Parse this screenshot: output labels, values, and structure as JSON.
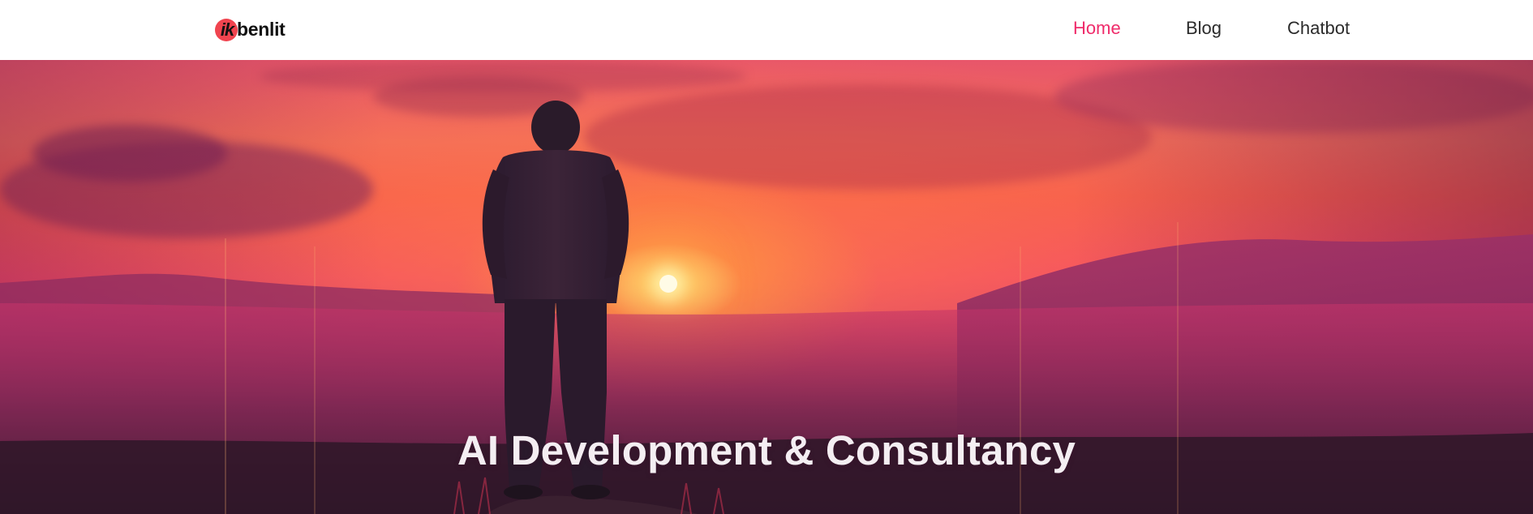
{
  "header": {
    "logo": {
      "mark_text": "ik",
      "word_text": "benlit",
      "mark_color": "#f0444f"
    },
    "nav": [
      {
        "label": "Home",
        "active": true
      },
      {
        "label": "Blog",
        "active": false
      },
      {
        "label": "Chatbot",
        "active": false
      }
    ],
    "active_color": "#ef2b6a"
  },
  "hero": {
    "title": "AI Development & Consultancy",
    "image": "sunset-silhouette-man-on-hill"
  }
}
